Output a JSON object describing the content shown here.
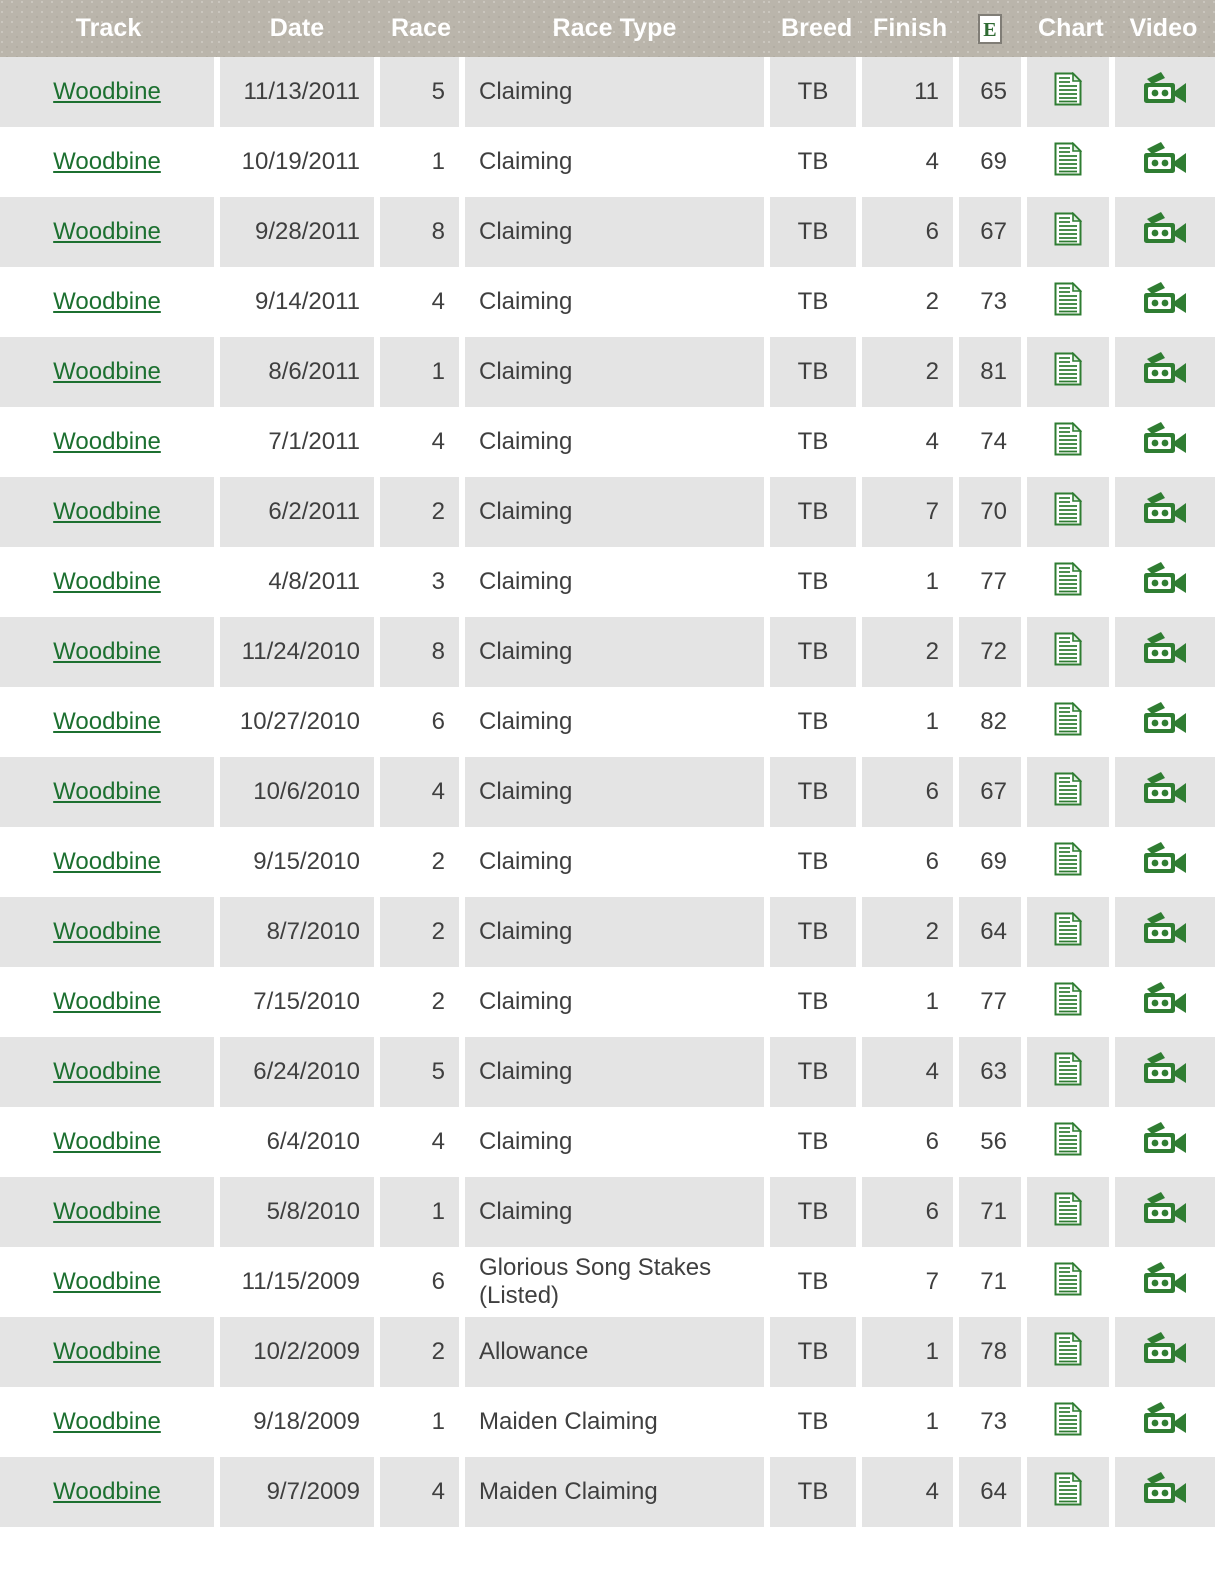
{
  "table": {
    "columns": [
      {
        "key": "track",
        "label": "Track",
        "icon": null
      },
      {
        "key": "date",
        "label": "Date",
        "icon": null
      },
      {
        "key": "race",
        "label": "Race",
        "icon": null
      },
      {
        "key": "type",
        "label": "Race Type",
        "icon": null
      },
      {
        "key": "breed",
        "label": "Breed",
        "icon": null
      },
      {
        "key": "finish",
        "label": "Finish",
        "icon": null
      },
      {
        "key": "equib",
        "label": "E",
        "icon": "equibase-e-badge-icon"
      },
      {
        "key": "chart",
        "label": "Chart",
        "icon": null
      },
      {
        "key": "video",
        "label": "Video",
        "icon": null
      }
    ],
    "row_icons": {
      "chart": "chart-document-icon",
      "video": "video-camera-icon"
    },
    "rows": [
      {
        "track": "Woodbine",
        "date": "11/13/2011",
        "race": "5",
        "type": "Claiming",
        "breed": "TB",
        "finish": "11",
        "equib": "65"
      },
      {
        "track": "Woodbine",
        "date": "10/19/2011",
        "race": "1",
        "type": "Claiming",
        "breed": "TB",
        "finish": "4",
        "equib": "69"
      },
      {
        "track": "Woodbine",
        "date": "9/28/2011",
        "race": "8",
        "type": "Claiming",
        "breed": "TB",
        "finish": "6",
        "equib": "67"
      },
      {
        "track": "Woodbine",
        "date": "9/14/2011",
        "race": "4",
        "type": "Claiming",
        "breed": "TB",
        "finish": "2",
        "equib": "73"
      },
      {
        "track": "Woodbine",
        "date": "8/6/2011",
        "race": "1",
        "type": "Claiming",
        "breed": "TB",
        "finish": "2",
        "equib": "81"
      },
      {
        "track": "Woodbine",
        "date": "7/1/2011",
        "race": "4",
        "type": "Claiming",
        "breed": "TB",
        "finish": "4",
        "equib": "74"
      },
      {
        "track": "Woodbine",
        "date": "6/2/2011",
        "race": "2",
        "type": "Claiming",
        "breed": "TB",
        "finish": "7",
        "equib": "70"
      },
      {
        "track": "Woodbine",
        "date": "4/8/2011",
        "race": "3",
        "type": "Claiming",
        "breed": "TB",
        "finish": "1",
        "equib": "77"
      },
      {
        "track": "Woodbine",
        "date": "11/24/2010",
        "race": "8",
        "type": "Claiming",
        "breed": "TB",
        "finish": "2",
        "equib": "72"
      },
      {
        "track": "Woodbine",
        "date": "10/27/2010",
        "race": "6",
        "type": "Claiming",
        "breed": "TB",
        "finish": "1",
        "equib": "82"
      },
      {
        "track": "Woodbine",
        "date": "10/6/2010",
        "race": "4",
        "type": "Claiming",
        "breed": "TB",
        "finish": "6",
        "equib": "67"
      },
      {
        "track": "Woodbine",
        "date": "9/15/2010",
        "race": "2",
        "type": "Claiming",
        "breed": "TB",
        "finish": "6",
        "equib": "69"
      },
      {
        "track": "Woodbine",
        "date": "8/7/2010",
        "race": "2",
        "type": "Claiming",
        "breed": "TB",
        "finish": "2",
        "equib": "64"
      },
      {
        "track": "Woodbine",
        "date": "7/15/2010",
        "race": "2",
        "type": "Claiming",
        "breed": "TB",
        "finish": "1",
        "equib": "77"
      },
      {
        "track": "Woodbine",
        "date": "6/24/2010",
        "race": "5",
        "type": "Claiming",
        "breed": "TB",
        "finish": "4",
        "equib": "63"
      },
      {
        "track": "Woodbine",
        "date": "6/4/2010",
        "race": "4",
        "type": "Claiming",
        "breed": "TB",
        "finish": "6",
        "equib": "56"
      },
      {
        "track": "Woodbine",
        "date": "5/8/2010",
        "race": "1",
        "type": "Claiming",
        "breed": "TB",
        "finish": "6",
        "equib": "71"
      },
      {
        "track": "Woodbine",
        "date": "11/15/2009",
        "race": "6",
        "type": "Glorious Song Stakes (Listed)",
        "breed": "TB",
        "finish": "7",
        "equib": "71"
      },
      {
        "track": "Woodbine",
        "date": "10/2/2009",
        "race": "2",
        "type": "Allowance",
        "breed": "TB",
        "finish": "1",
        "equib": "78"
      },
      {
        "track": "Woodbine",
        "date": "9/18/2009",
        "race": "1",
        "type": "Maiden Claiming",
        "breed": "TB",
        "finish": "1",
        "equib": "73"
      },
      {
        "track": "Woodbine",
        "date": "9/7/2009",
        "race": "4",
        "type": "Maiden Claiming",
        "breed": "TB",
        "finish": "4",
        "equib": "64"
      }
    ]
  },
  "colors": {
    "header_background": "#bab5ab",
    "header_text": "#ffffff",
    "row_shaded": "#e4e4e4",
    "row_plain": "#ffffff",
    "link_green": "#1c7030",
    "icon_green": "#2f7d32",
    "body_text": "#3f3f3f"
  }
}
